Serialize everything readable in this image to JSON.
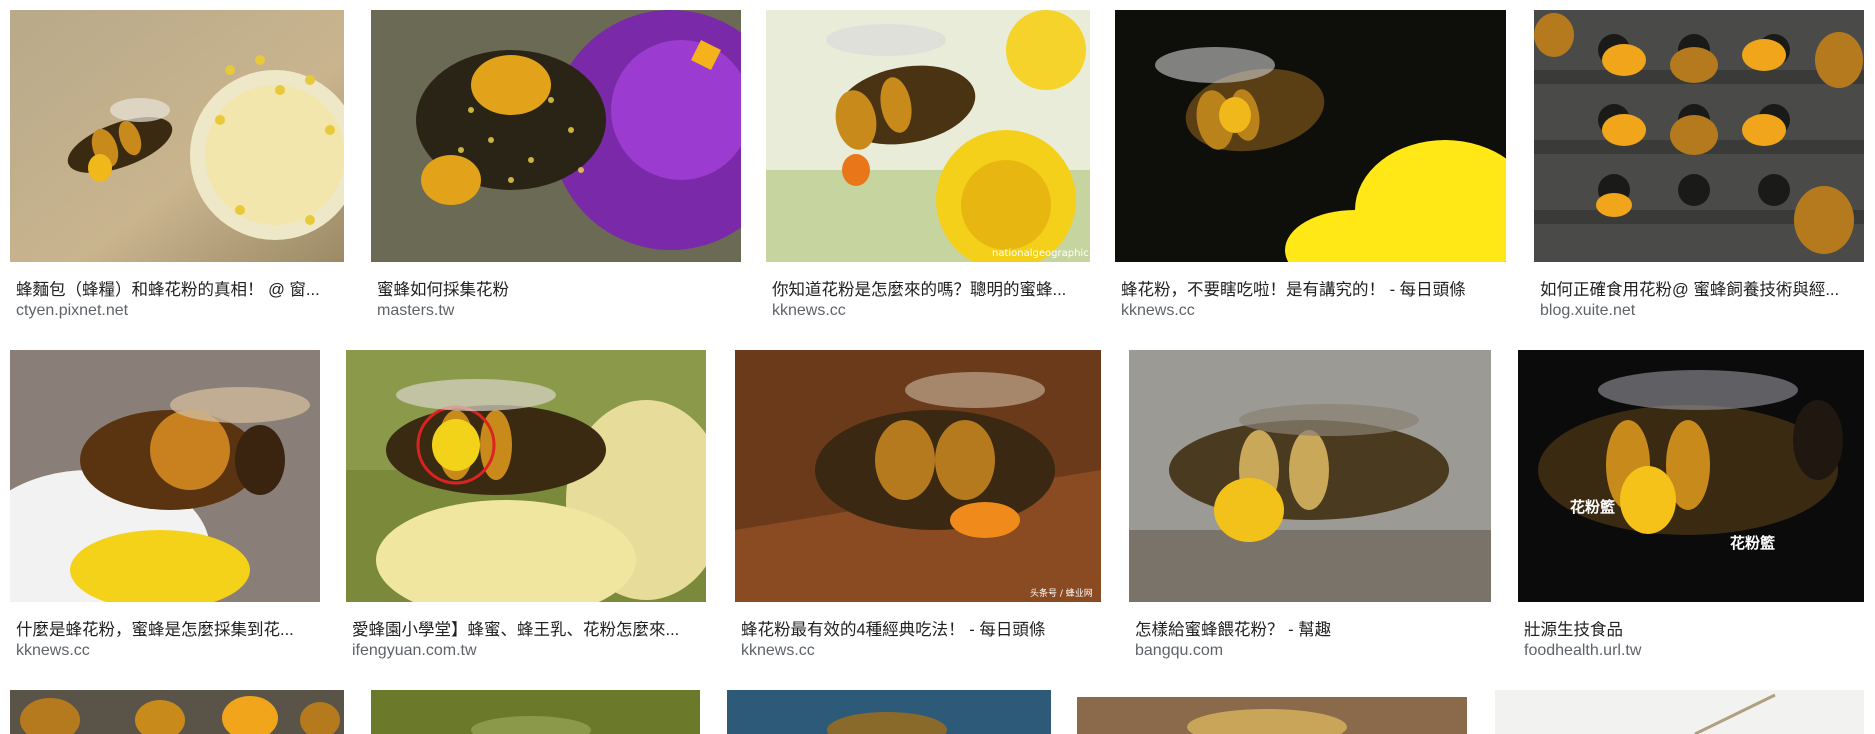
{
  "results": [
    {
      "title": "蜂麵包（蜂糧）和蜂花粉的真相！ @ 窗...",
      "source": "ctyen.pixnet.net"
    },
    {
      "title": "蜜蜂如何採集花粉",
      "source": "masters.tw"
    },
    {
      "title": "你知道花粉是怎麼來的嗎？聰明的蜜蜂...",
      "source": "kknews.cc",
      "watermark": "nationalgeographic.com"
    },
    {
      "title": "蜂花粉，不要瞎吃啦！是有講究的！ - 每日頭條",
      "source": "kknews.cc"
    },
    {
      "title": "如何正確食用花粉@ 蜜蜂飼養技術與經...",
      "source": "blog.xuite.net"
    },
    {
      "title": "什麼是蜂花粉，蜜蜂是怎麼採集到花...",
      "source": "kknews.cc"
    },
    {
      "title": "愛蜂園小學堂】蜂蜜、蜂王乳、花粉怎麼來...",
      "source": "ifengyuan.com.tw"
    },
    {
      "title": "蜂花粉最有效的4種經典吃法！ - 每日頭條",
      "source": "kknews.cc",
      "watermark": "头条号 / 蜂业网"
    },
    {
      "title": "怎樣給蜜蜂餵花粉？ - 幫趣",
      "source": "bangqu.com"
    },
    {
      "title": "壯源生技食品",
      "source": "foodhealth.url.tw",
      "labels": [
        "花粉籃",
        "花粉籃"
      ]
    }
  ],
  "colors": {
    "title_text": "#222222",
    "source_text": "#5f6368",
    "bee_body": "#3a2a12",
    "bee_stripe": "#c98a1c",
    "pollen": "#f4a21a",
    "flower_yellow": "#f3d21a"
  }
}
